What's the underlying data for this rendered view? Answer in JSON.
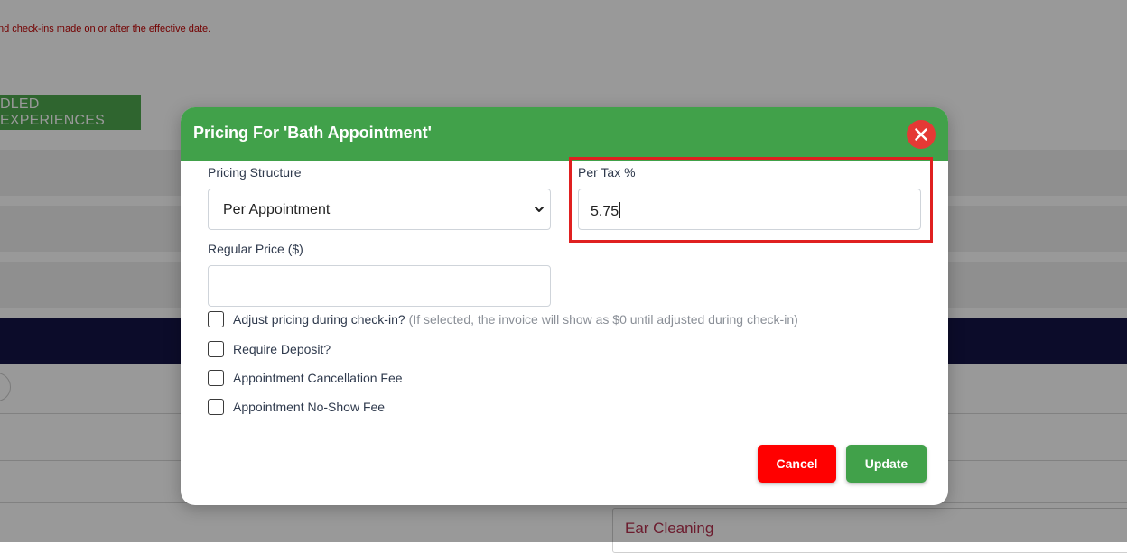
{
  "background": {
    "notice_text": "nd check-ins made on or after the effective date.",
    "bundled_button_label": "DLED EXPERIENCES",
    "ear_cleaning_value": "Ear Cleaning"
  },
  "modal": {
    "title": "Pricing For 'Bath Appointment'",
    "close_icon": "close-icon",
    "pricing_structure": {
      "label": "Pricing Structure",
      "selected": "Per Appointment"
    },
    "per_tax": {
      "label": "Per Tax %",
      "value": "5.75"
    },
    "regular_price": {
      "label": "Regular Price ($)",
      "value": ""
    },
    "checkboxes": [
      {
        "label": "Adjust pricing during check-in?",
        "hint": "(If selected, the invoice will show as $0 until adjusted during check-in)",
        "checked": false
      },
      {
        "label": "Require Deposit?",
        "hint": "",
        "checked": false
      },
      {
        "label": "Appointment Cancellation Fee",
        "hint": "",
        "checked": false
      },
      {
        "label": "Appointment No-Show Fee",
        "hint": "",
        "checked": false
      }
    ],
    "buttons": {
      "cancel_label": "Cancel",
      "update_label": "Update"
    }
  },
  "colors": {
    "header_green": "#41a14a",
    "cancel_red": "#ff0000",
    "highlight_red": "#e02020",
    "close_red": "#e53935"
  }
}
